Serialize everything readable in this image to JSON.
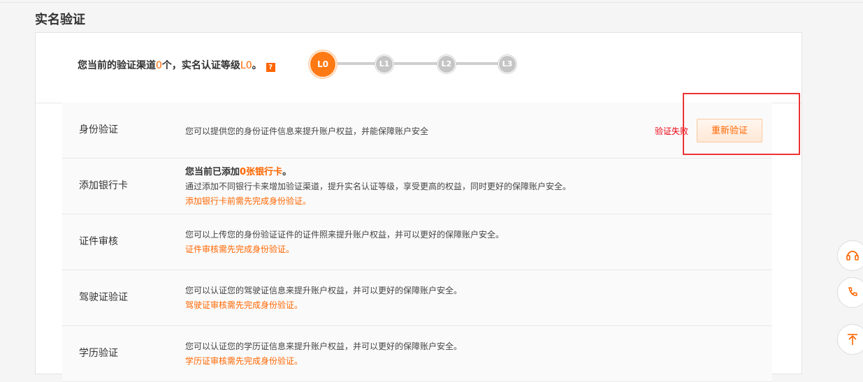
{
  "page": {
    "title": "实名验证"
  },
  "level": {
    "prefix": "您当前的验证渠道",
    "channel_count": "0",
    "middle": "个，实名认证等级",
    "level_value": "L0",
    "suffix": "。",
    "help_icon": "question-icon",
    "steps": [
      "L0",
      "L1",
      "L2",
      "L3"
    ],
    "active_step": "L0"
  },
  "rows": [
    {
      "name": "身份验证",
      "desc": "您可以提供您的身份证件信息来提升账户权益，并能保障账户安全",
      "status": "验证失败",
      "button": "重新验证"
    },
    {
      "name": "添加银行卡",
      "headline_prefix": "您当前已添加",
      "headline_count": "0张银行卡",
      "headline_suffix": "。",
      "desc": "通过添加不同银行卡来增加验证渠道，提升实名认证等级，享受更高的权益，同时更好的保障账户安全。",
      "note": "添加银行卡前需先完成身份验证。"
    },
    {
      "name": "证件审核",
      "desc": "您可以上传您的身份验证证件的证件照来提升账户权益，并可以更好的保障账户安全。",
      "note": "证件审核需先完成身份验证。"
    },
    {
      "name": "驾驶证验证",
      "desc": "您可以认证您的驾驶证信息来提升账户权益，并可以更好的保障账户安全。",
      "note": "驾驶证审核需先完成身份验证。"
    },
    {
      "name": "学历验证",
      "desc": "您可以认证您的学历证信息来提升账户权益，并可以更好的保障账户安全。",
      "note": "学历证审核需先完成身份验证。"
    }
  ],
  "side_tools": [
    {
      "icon": "customer-service-icon"
    },
    {
      "icon": "phone-icon"
    },
    {
      "icon": "back-to-top-icon"
    }
  ],
  "colors": {
    "accent": "#ff6600",
    "error": "#ee1111",
    "highlight": "#ee3333"
  }
}
